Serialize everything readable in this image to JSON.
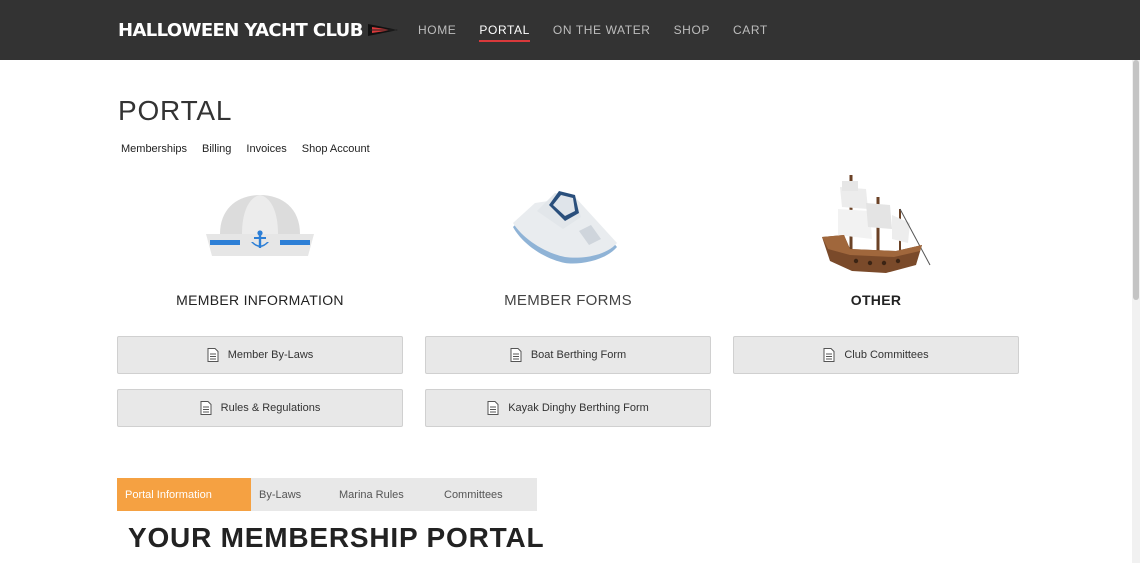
{
  "header": {
    "brand": "HALLOWEEN YACHT CLUB",
    "nav": [
      {
        "label": "HOME",
        "active": false
      },
      {
        "label": "PORTAL",
        "active": true
      },
      {
        "label": "ON THE WATER",
        "active": false
      },
      {
        "label": "SHOP",
        "active": false
      },
      {
        "label": "CART",
        "active": false
      }
    ],
    "accent_color": "#d9393b",
    "bar_color": "#333333"
  },
  "portal": {
    "title": "PORTAL",
    "subnav": [
      "Memberships",
      "Billing",
      "Invoices",
      "Shop Account"
    ]
  },
  "columns": [
    {
      "icon": "sailor-hat-icon",
      "heading": "MEMBER INFORMATION",
      "buttons": [
        "Member By-Laws",
        "Rules & Regulations"
      ]
    },
    {
      "icon": "speedboat-icon",
      "heading": "MEMBER FORMS",
      "buttons": [
        "Boat Berthing Form",
        "Kayak Dinghy Berthing Form"
      ]
    },
    {
      "icon": "galleon-ship-icon",
      "heading": "OTHER",
      "buttons": [
        "Club Committees"
      ]
    }
  ],
  "tabs": {
    "items": [
      "Portal Information",
      "By-Laws",
      "Marina Rules",
      "Committees"
    ],
    "active_index": 0,
    "active_color": "#f5a142"
  },
  "section": {
    "heading": "YOUR MEMBERSHIP PORTAL"
  }
}
